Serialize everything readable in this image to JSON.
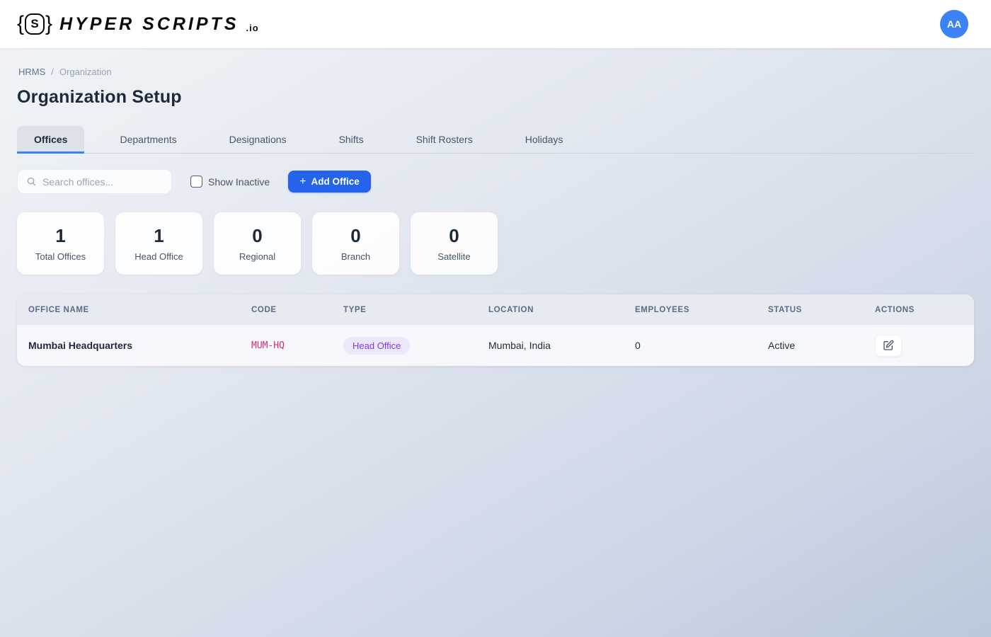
{
  "header": {
    "logo_brace_left": "{",
    "logo_mark": "S",
    "logo_brace_right": "}",
    "logo_text": "HYPER SCRIPTS",
    "logo_suffix": ".io",
    "avatar_initials": "AA"
  },
  "breadcrumb": {
    "root": "HRMS",
    "separator": "/",
    "current": "Organization"
  },
  "page": {
    "title": "Organization Setup"
  },
  "tabs": [
    {
      "label": "Offices",
      "active": true
    },
    {
      "label": "Departments",
      "active": false
    },
    {
      "label": "Designations",
      "active": false
    },
    {
      "label": "Shifts",
      "active": false
    },
    {
      "label": "Shift Rosters",
      "active": false
    },
    {
      "label": "Holidays",
      "active": false
    }
  ],
  "toolbar": {
    "search_placeholder": "Search offices...",
    "search_value": "",
    "show_inactive_label": "Show Inactive",
    "show_inactive_checked": false,
    "add_icon": "+",
    "add_label": "Add Office"
  },
  "stats": [
    {
      "value": "1",
      "label": "Total Offices"
    },
    {
      "value": "1",
      "label": "Head Office"
    },
    {
      "value": "0",
      "label": "Regional"
    },
    {
      "value": "0",
      "label": "Branch"
    },
    {
      "value": "0",
      "label": "Satellite"
    }
  ],
  "table": {
    "columns": [
      "OFFICE NAME",
      "CODE",
      "TYPE",
      "LOCATION",
      "EMPLOYEES",
      "STATUS",
      "ACTIONS"
    ],
    "rows": [
      {
        "name": "Mumbai Headquarters",
        "code": "MUM-HQ",
        "type": "Head Office",
        "location": "Mumbai, India",
        "employees": "0",
        "status": "Active"
      }
    ]
  },
  "colors": {
    "accent": "#2563eb",
    "avatar_bg": "#3b82f6",
    "tab_underline": "#3b82f6",
    "code_text": "#db2777",
    "type_badge_bg": "#ece8fb",
    "type_badge_text": "#7c3aed"
  }
}
